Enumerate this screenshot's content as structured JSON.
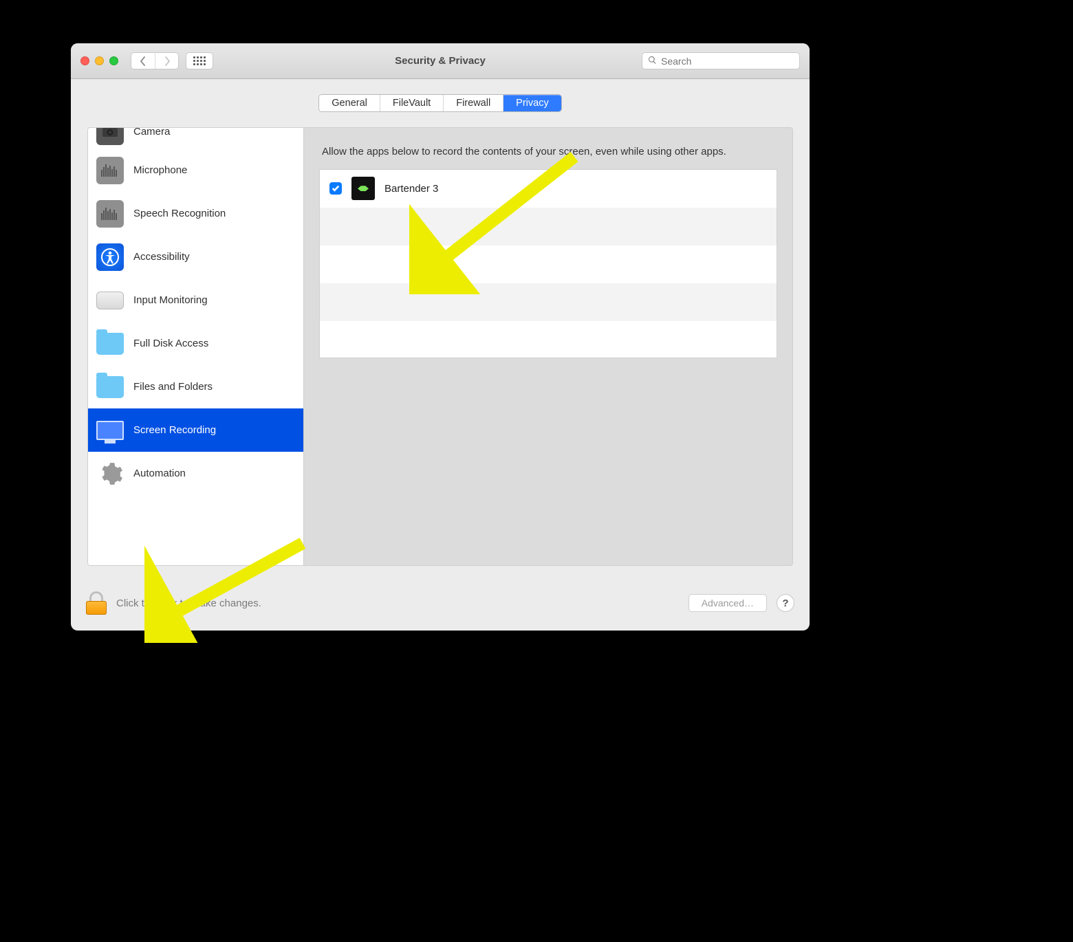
{
  "window": {
    "title": "Security & Privacy"
  },
  "search": {
    "placeholder": "Search"
  },
  "tabs": [
    {
      "label": "General",
      "selected": false
    },
    {
      "label": "FileVault",
      "selected": false
    },
    {
      "label": "Firewall",
      "selected": false
    },
    {
      "label": "Privacy",
      "selected": true
    }
  ],
  "sidebar": {
    "categories": [
      {
        "label": "Camera",
        "icon": "camera-icon",
        "selected": false
      },
      {
        "label": "Microphone",
        "icon": "microphone-icon",
        "selected": false
      },
      {
        "label": "Speech Recognition",
        "icon": "speech-icon",
        "selected": false
      },
      {
        "label": "Accessibility",
        "icon": "accessibility-icon",
        "selected": false
      },
      {
        "label": "Input Monitoring",
        "icon": "keyboard-icon",
        "selected": false
      },
      {
        "label": "Full Disk Access",
        "icon": "folder-icon",
        "selected": false
      },
      {
        "label": "Files and Folders",
        "icon": "folder-icon",
        "selected": false
      },
      {
        "label": "Screen Recording",
        "icon": "display-icon",
        "selected": true
      },
      {
        "label": "Automation",
        "icon": "gear-icon",
        "selected": false
      }
    ]
  },
  "detail": {
    "description": "Allow the apps below to record the contents of your screen, even while using other apps.",
    "apps": [
      {
        "name": "Bartender 3",
        "checked": true
      }
    ]
  },
  "footer": {
    "lock_label": "Click the lock to make changes.",
    "advanced_label": "Advanced…",
    "help_label": "?"
  }
}
